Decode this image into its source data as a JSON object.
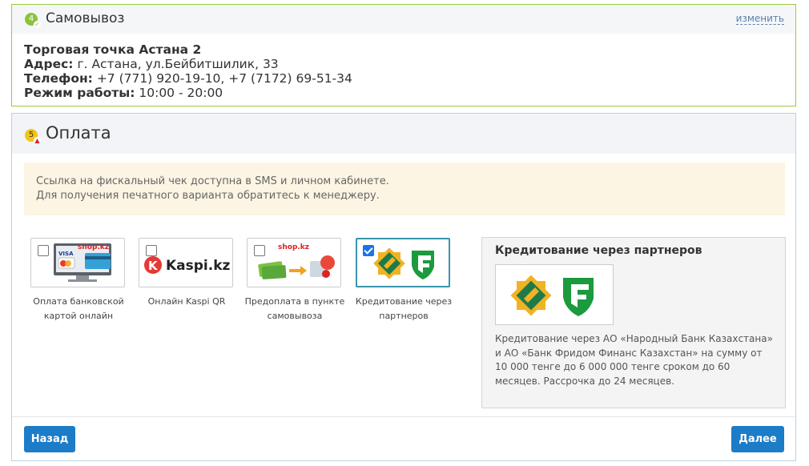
{
  "pickup_section": {
    "step_number": "4",
    "title": "Самовывоз",
    "change_link": "изменить",
    "store_name": "Торговая точка Астана 2",
    "address_label": "Адрес:",
    "address_value": " г. Астана, ул.Бейбитшилик, 33",
    "phone_label": "Телефон:",
    "phone_value": " +7 (771) 920-19-10, +7 (7172) 69-51-34",
    "hours_label": "Режим работы:",
    "hours_value": " 10:00 - 20:00",
    "status_color": "#8dc23e"
  },
  "payment_section": {
    "step_number": "5",
    "title": "Оплата",
    "notice_line1": "Ссылка на фискальный чек доступна в SMS и личном кабинете.",
    "notice_line2": "Для получения печатного варианта обратитесь к менеджеру.",
    "methods": [
      {
        "caption_line1": "Оплата банковской",
        "caption_line2": "картой онлайн",
        "logo_text": "shop.kz",
        "checked": false,
        "icon": "card-payment-icon"
      },
      {
        "caption_line1": "Онлайн Kaspi QR",
        "caption_line2": "",
        "logo_text": "Kaspi.kz",
        "checked": false,
        "icon": "kaspi-logo-icon"
      },
      {
        "caption_line1": "Предоплата в пункте",
        "caption_line2": "самовывоза",
        "logo_text": "shop.kz",
        "checked": false,
        "icon": "prepayment-icon"
      },
      {
        "caption_line1": "Кредитование через",
        "caption_line2": "партнеров",
        "logo_text": "",
        "checked": true,
        "icon": "partner-banks-icon"
      }
    ],
    "credit_panel": {
      "title": "Кредитование через партнеров",
      "description": "Кредитование через АО «Народный Банк Казахстана» и АО «Банк Фридом Финанс Казахстан» на сумму от 10 000 тенге до 6 000 000 тенге сроком до 60 месяцев. Рассрочка до 24 месяцев."
    },
    "back_button": "Назад",
    "next_button": "Далее",
    "accent_color": "#1c7cc7"
  }
}
